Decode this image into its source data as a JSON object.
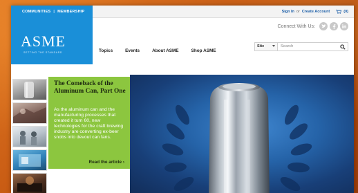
{
  "topbar": {
    "communities": "COMMUNITIES",
    "membership": "MEMBERSHIP",
    "sign_in": "Sign In",
    "or": "or",
    "create_account": "Create Account",
    "cart_count": "(0)"
  },
  "logo": {
    "name": "ASME",
    "tagline": "SETTING THE STANDARD"
  },
  "connect": {
    "label": "Connect With Us:",
    "icons": [
      "twitter-icon",
      "facebook-icon",
      "linkedin-icon"
    ]
  },
  "nav": {
    "items": [
      "Topics",
      "Events",
      "About ASME",
      "Shop ASME"
    ]
  },
  "search": {
    "scope": "Site",
    "placeholder": "Search"
  },
  "feature": {
    "title": "The Comeback of the Aluminum Can, Part One",
    "body": "As the aluminum can and the manufacturing processes that created it turn 60, new technologies for the craft brewing industry are converting ex-beer snobs into devout can fans.",
    "link": "Read the article ›"
  },
  "colors": {
    "brand_blue": "#1a8fd8",
    "feature_green": "#8cc63f",
    "background_orange": "#c95a16"
  }
}
